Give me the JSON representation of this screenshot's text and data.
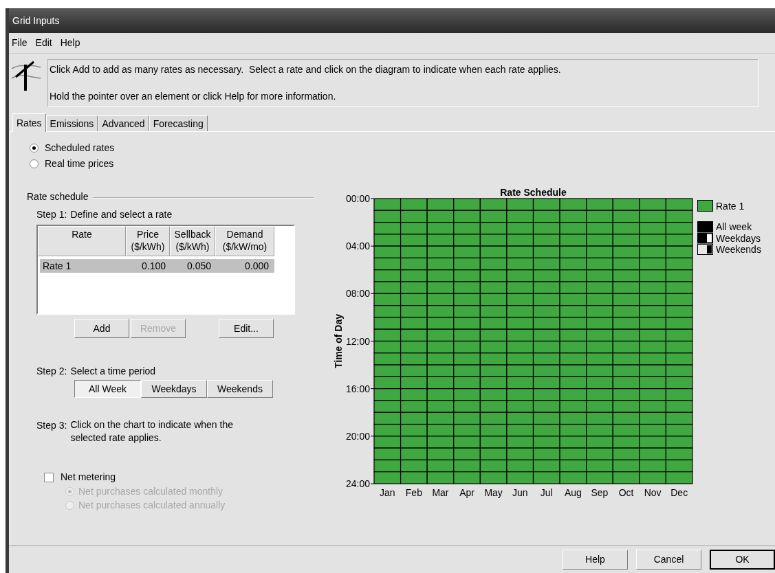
{
  "window": {
    "title": "Grid Inputs"
  },
  "menu": [
    "File",
    "Edit",
    "Help"
  ],
  "info": {
    "lines": [
      "Click Add to add as many rates as necessary.  Select a rate and click on the diagram to indicate when each rate applies.",
      "Hold the pointer over an element or click Help for more information."
    ]
  },
  "tabs": [
    {
      "label": "Rates",
      "selected": true
    },
    {
      "label": "Emissions",
      "selected": false
    },
    {
      "label": "Advanced",
      "selected": false
    },
    {
      "label": "Forecasting",
      "selected": false
    }
  ],
  "rate_mode": [
    {
      "label": "Scheduled rates",
      "selected": true
    },
    {
      "label": "Real time prices",
      "selected": false
    }
  ],
  "rate_schedule": {
    "title": "Rate schedule",
    "step1": {
      "label": "Step 1:",
      "text": "Define and select a rate"
    },
    "table": {
      "columns": [
        {
          "lines": [
            "Rate"
          ]
        },
        {
          "lines": [
            "Price",
            "($/kWh)"
          ]
        },
        {
          "lines": [
            "Sellback",
            "($/kWh)"
          ]
        },
        {
          "lines": [
            "Demand",
            "($/kW/mo)"
          ]
        }
      ],
      "rows": [
        {
          "cells": [
            "Rate 1",
            "0.100",
            "0.050",
            "0.000"
          ],
          "selected": true
        }
      ]
    },
    "buttons": [
      {
        "label": "Add",
        "disabled": false
      },
      {
        "label": "Remove",
        "disabled": true
      },
      {
        "label": "Edit...",
        "disabled": false
      }
    ],
    "step2": {
      "label": "Step 2:",
      "text": "Select a time period"
    },
    "periods": [
      {
        "label": "All Week",
        "selected": true
      },
      {
        "label": "Weekdays",
        "selected": false
      },
      {
        "label": "Weekends",
        "selected": false
      }
    ],
    "step3": {
      "label": "Step 3:",
      "text": "Click on the chart to indicate when the selected rate applies."
    }
  },
  "net_metering": {
    "label": "Net metering",
    "checked": false,
    "options": [
      {
        "label": "Net purchases calculated monthly",
        "selected": true
      },
      {
        "label": "Net purchases calculated annually",
        "selected": false
      }
    ]
  },
  "schedule_chart": {
    "title": "Rate Schedule",
    "ylabel": "Time of Day",
    "yticks": [
      "00:00",
      "04:00",
      "08:00",
      "12:00",
      "16:00",
      "20:00",
      "24:00"
    ],
    "months": [
      "Jan",
      "Feb",
      "Mar",
      "Apr",
      "May",
      "Jun",
      "Jul",
      "Aug",
      "Sep",
      "Oct",
      "Nov",
      "Dec"
    ],
    "rates": [
      {
        "label": "Rate 1",
        "color": "#40a840"
      }
    ],
    "period_legend": [
      {
        "label": "All week",
        "kind": "all"
      },
      {
        "label": "Weekdays",
        "kind": "weekdays"
      },
      {
        "label": "Weekends",
        "kind": "weekends"
      }
    ]
  },
  "footer_buttons": [
    {
      "label": "Help",
      "default": false
    },
    {
      "label": "Cancel",
      "default": false
    },
    {
      "label": "OK",
      "default": true
    }
  ]
}
